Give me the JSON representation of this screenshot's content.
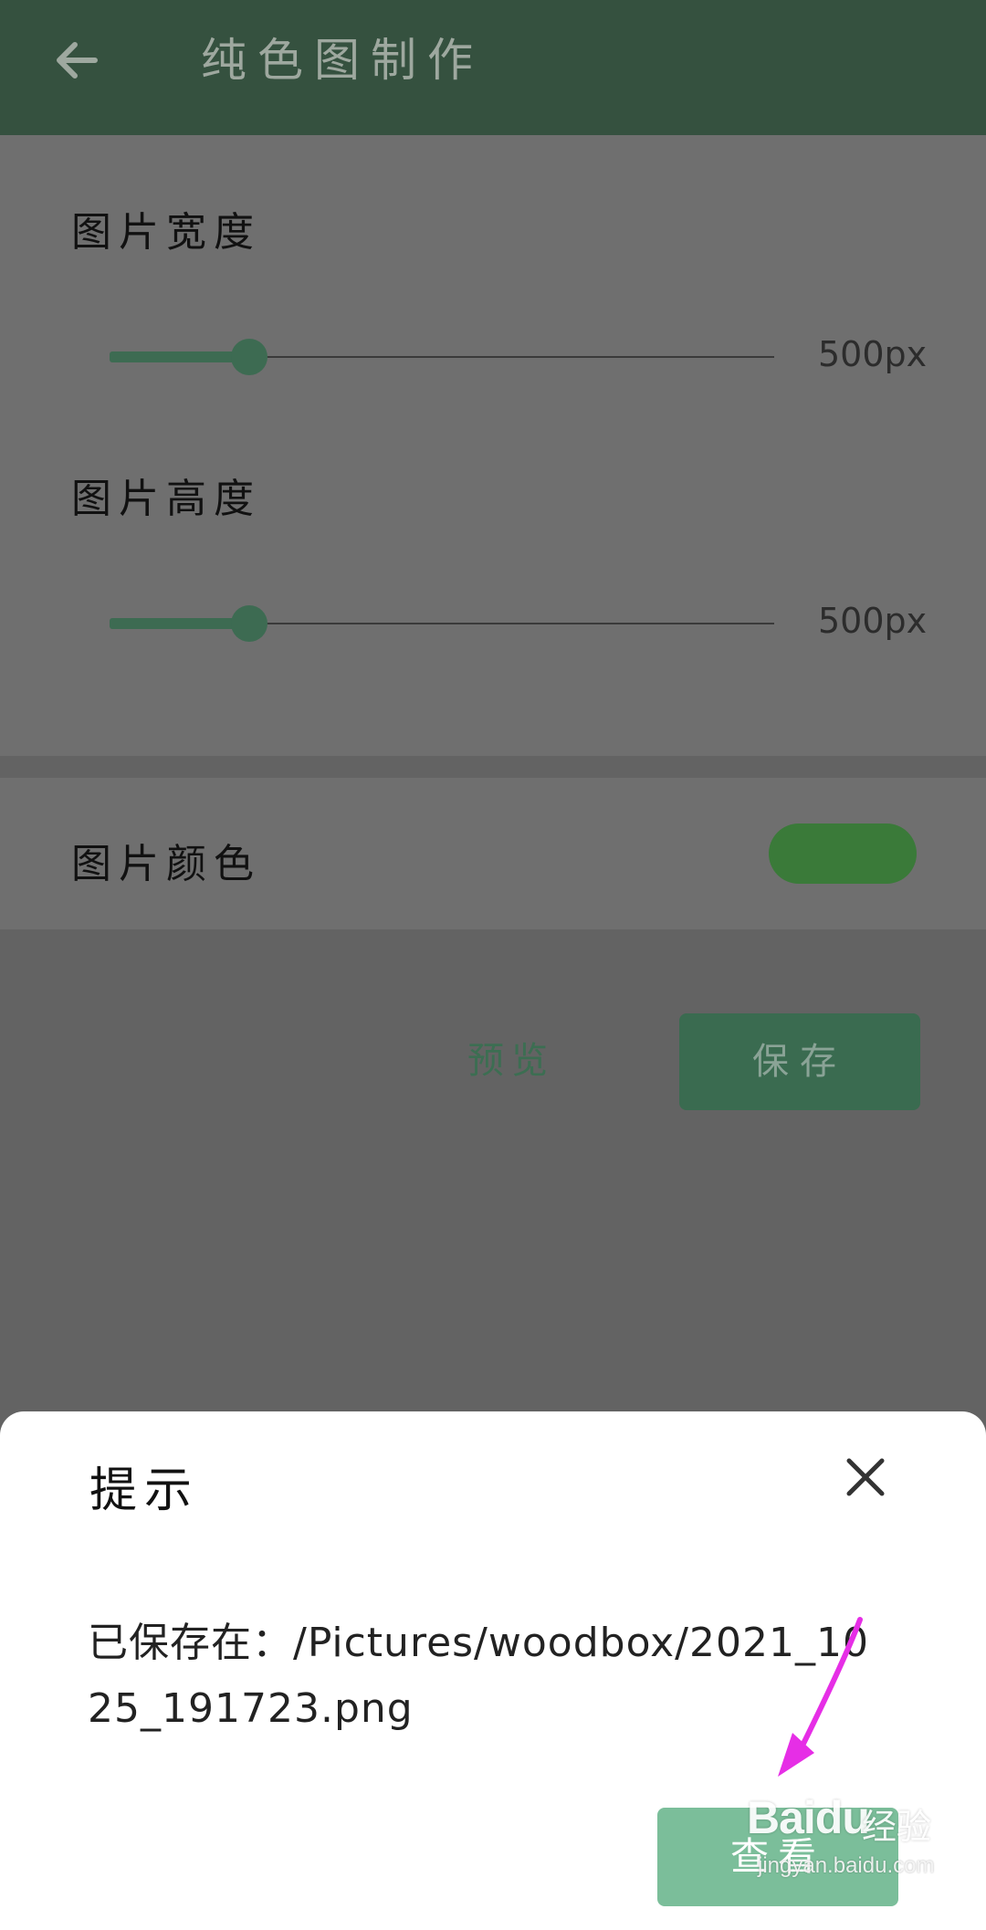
{
  "app_bar": {
    "title": "纯色图制作",
    "back_icon": "arrow-left-icon"
  },
  "settings": {
    "width": {
      "label": "图片宽度",
      "value_text": "500px",
      "level": 0.21
    },
    "height": {
      "label": "图片高度",
      "value_text": "500px",
      "level": 0.21
    },
    "color": {
      "label": "图片颜色",
      "swatch_color": "#3a7a39"
    }
  },
  "actions": {
    "preview_label": "预览",
    "save_label": "保存"
  },
  "dialog": {
    "title": "提示",
    "close_icon": "close-icon",
    "message": "已保存在：/Pictures/woodbox/2021_1025_191723.png",
    "view_label": "查看"
  },
  "watermark": {
    "brand": "Baidu",
    "suffix": "经验",
    "url": "jingyan.baidu.com"
  },
  "colors": {
    "app_bar": "#35513f",
    "accent": "#3d6b52",
    "view_button": "#7bbe9a",
    "annotation_arrow": "#e62ee6"
  }
}
